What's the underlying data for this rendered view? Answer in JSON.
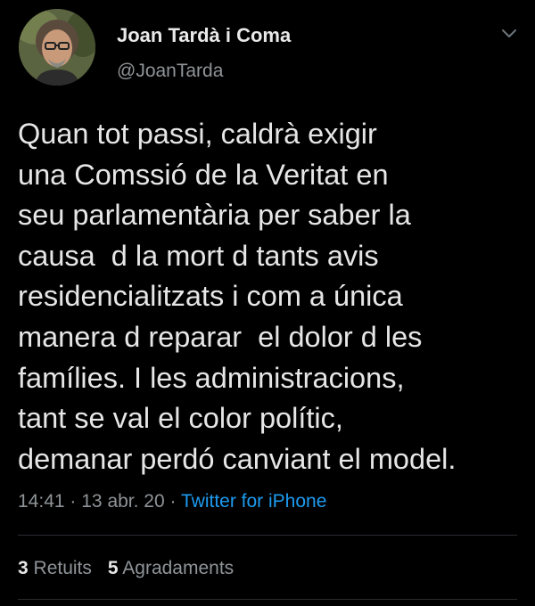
{
  "author": {
    "name": "Joan Tardà i Coma",
    "handle": "@JoanTarda"
  },
  "tweet": {
    "lines": [
      "Quan tot passi, caldrà exigir",
      "una Comssió de la Veritat en",
      "seu parlamentària per saber la",
      "causa  d la mort d tants avis",
      "residencialitzats i com a única",
      "manera d reparar  el dolor d les",
      "famílies. I les administracions,",
      "tant se val el color polític,",
      "demanar perdó canviant el model."
    ],
    "time": "14:41",
    "date": "13 abr. 20",
    "separator": "·",
    "source": "Twitter for iPhone"
  },
  "stats": {
    "retweets_count": "3",
    "retweets_label": "Retuits",
    "likes_count": "5",
    "likes_label": "Agradaments"
  },
  "icons": {
    "menu": "chevron-down-icon",
    "avatar": "profile-photo"
  },
  "colors": {
    "background": "#000000",
    "link": "#1d9bf0",
    "secondary_text": "#8f9498",
    "primary_text": "#e6e6e6"
  }
}
